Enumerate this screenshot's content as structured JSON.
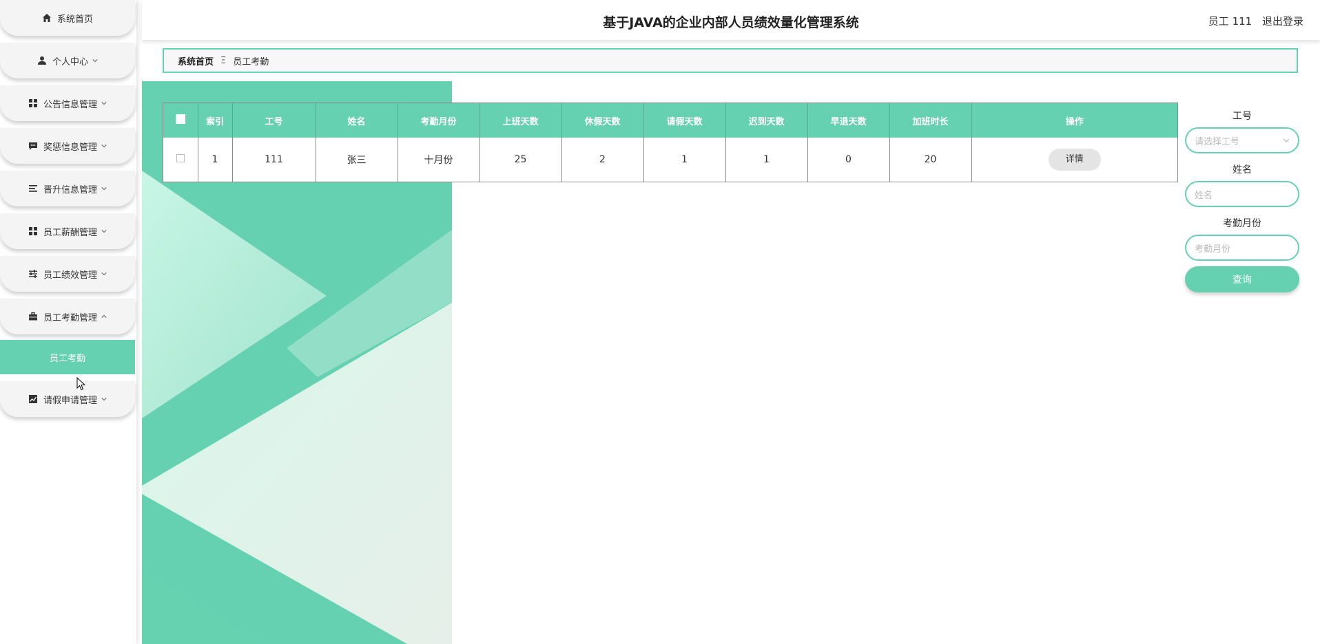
{
  "header": {
    "title": "基于JAVA的企业内部人员绩效量化管理系统",
    "user_label": "员工 111",
    "logout_label": "退出登录"
  },
  "sidebar": {
    "items": [
      {
        "label": "系统首页",
        "icon": "home-icon"
      },
      {
        "label": "个人中心",
        "icon": "person-icon"
      },
      {
        "label": "公告信息管理",
        "icon": "grid-icon"
      },
      {
        "label": "奖惩信息管理",
        "icon": "chat-icon"
      },
      {
        "label": "晋升信息管理",
        "icon": "list-icon"
      },
      {
        "label": "员工薪酬管理",
        "icon": "grid-icon"
      },
      {
        "label": "员工绩效管理",
        "icon": "sliders-icon"
      },
      {
        "label": "员工考勤管理",
        "icon": "briefcase-icon"
      },
      {
        "label": "请假申请管理",
        "icon": "chart-icon"
      }
    ],
    "submenu_label": "员工考勤"
  },
  "breadcrumb": {
    "home": "系统首页",
    "separator": "Ξ",
    "current": "员工考勤"
  },
  "table": {
    "headers": [
      "索引",
      "工号",
      "姓名",
      "考勤月份",
      "上班天数",
      "休假天数",
      "请假天数",
      "迟到天数",
      "早退天数",
      "加班时长",
      "操作"
    ],
    "rows": [
      {
        "index": "1",
        "id": "111",
        "name": "张三",
        "month": "十月份",
        "work_days": "25",
        "vacation_days": "2",
        "leave_days": "1",
        "late_days": "1",
        "early_days": "0",
        "overtime": "20",
        "action": "详情"
      }
    ]
  },
  "search": {
    "id_label": "工号",
    "id_placeholder": "请选择工号",
    "name_label": "姓名",
    "name_placeholder": "姓名",
    "month_label": "考勤月份",
    "month_placeholder": "考勤月份",
    "button": "查询"
  },
  "colors": {
    "accent": "#66d1b0"
  }
}
